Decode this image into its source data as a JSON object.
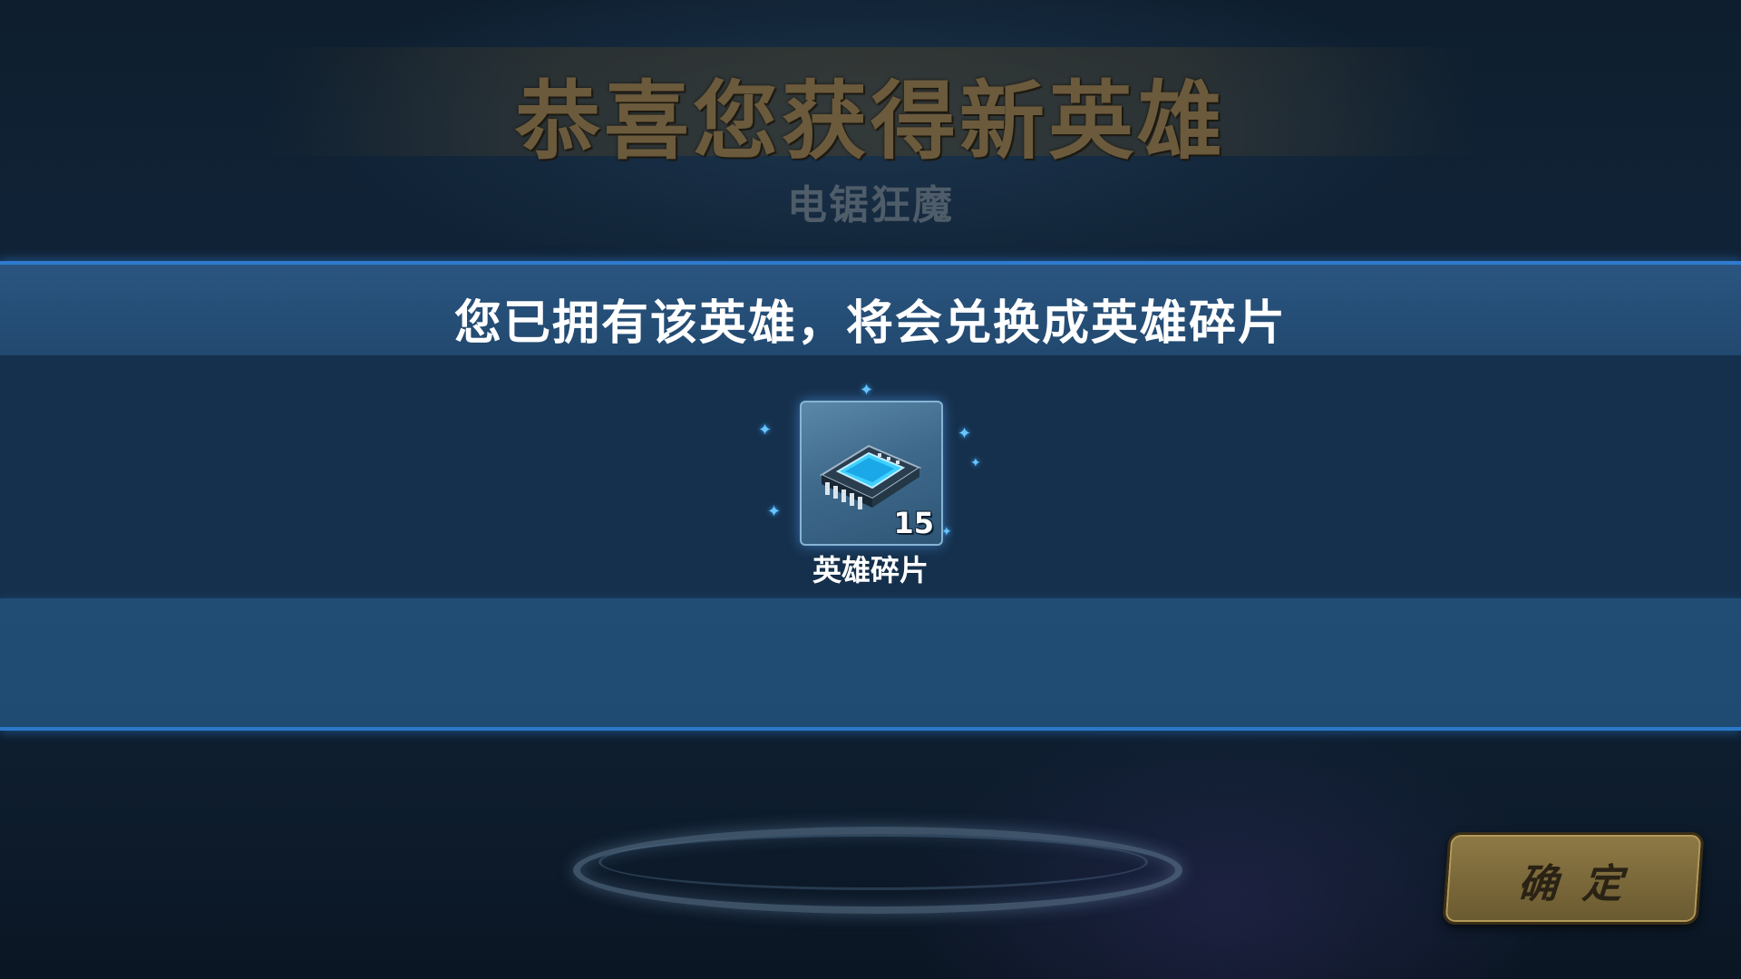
{
  "header": {
    "title": "恭喜您获得新英雄",
    "hero_name": "电锯狂魔"
  },
  "notice": {
    "text": "您已拥有该英雄，将会兑换成英雄碎片"
  },
  "reward": {
    "icon": "chip-icon",
    "count": "15",
    "label": "英雄碎片"
  },
  "actions": {
    "confirm_label": "确 定"
  },
  "colors": {
    "title": "#6b5a3c",
    "notice_bar": "#2a5580",
    "accent_line": "#2f7bd0",
    "button": "#8f7a45"
  }
}
